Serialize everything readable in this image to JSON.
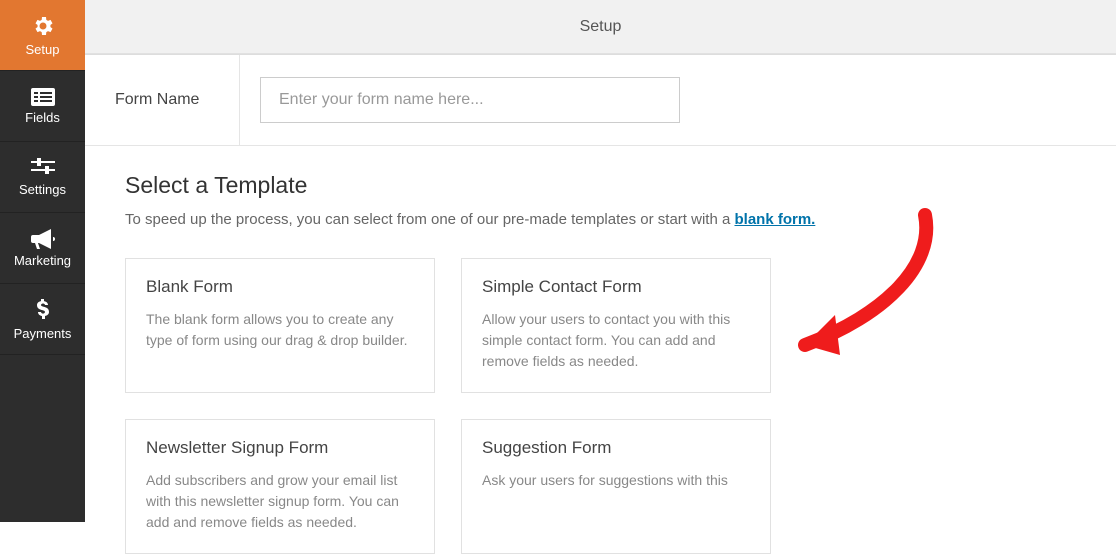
{
  "sidebar": {
    "items": [
      {
        "label": "Setup",
        "icon": "gear-icon"
      },
      {
        "label": "Fields",
        "icon": "list-icon"
      },
      {
        "label": "Settings",
        "icon": "sliders-icon"
      },
      {
        "label": "Marketing",
        "icon": "bullhorn-icon"
      },
      {
        "label": "Payments",
        "icon": "dollar-icon"
      }
    ]
  },
  "topbar": {
    "title": "Setup"
  },
  "form_name": {
    "label": "Form Name",
    "placeholder": "Enter your form name here..."
  },
  "template_section": {
    "title": "Select a Template",
    "subtitle_prefix": "To speed up the process, you can select from one of our pre-made templates or start with a ",
    "blank_link_text": "blank form."
  },
  "templates": [
    {
      "title": "Blank Form",
      "desc": "The blank form allows you to create any type of form using our drag & drop builder."
    },
    {
      "title": "Simple Contact Form",
      "desc": "Allow your users to contact you with this simple contact form. You can add and remove fields as needed."
    },
    {
      "title": "Newsletter Signup Form",
      "desc": "Add subscribers and grow your email list with this newsletter signup form. You can add and remove fields as needed."
    },
    {
      "title": "Suggestion Form",
      "desc": "Ask your users for suggestions with this"
    }
  ]
}
